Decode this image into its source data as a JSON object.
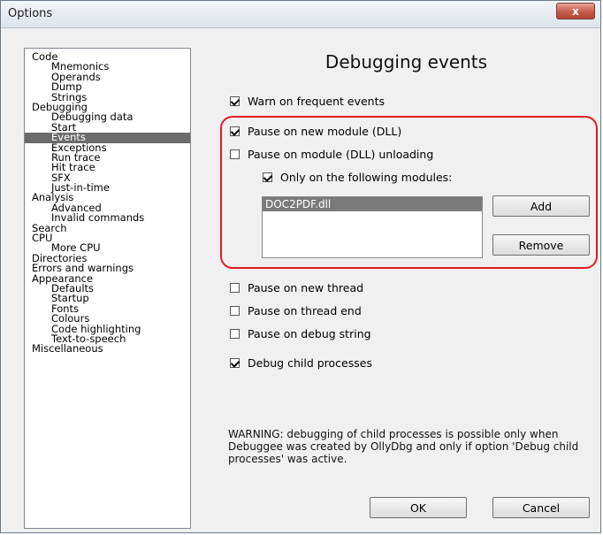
{
  "window": {
    "title": "Options",
    "close_label": "x"
  },
  "tree": {
    "items": [
      {
        "label": "Code",
        "level": 0
      },
      {
        "label": "Mnemonics",
        "level": 1
      },
      {
        "label": "Operands",
        "level": 1
      },
      {
        "label": "Dump",
        "level": 1
      },
      {
        "label": "Strings",
        "level": 1
      },
      {
        "label": "Debugging",
        "level": 0
      },
      {
        "label": "Debugging data",
        "level": 1
      },
      {
        "label": "Start",
        "level": 1
      },
      {
        "label": "Events",
        "level": 1,
        "selected": true
      },
      {
        "label": "Exceptions",
        "level": 1
      },
      {
        "label": "Run trace",
        "level": 1
      },
      {
        "label": "Hit trace",
        "level": 1
      },
      {
        "label": "SFX",
        "level": 1
      },
      {
        "label": "Just-in-time",
        "level": 1
      },
      {
        "label": "Analysis",
        "level": 0
      },
      {
        "label": "Advanced",
        "level": 1
      },
      {
        "label": "Invalid commands",
        "level": 1
      },
      {
        "label": "Search",
        "level": 0
      },
      {
        "label": "CPU",
        "level": 0
      },
      {
        "label": "More CPU",
        "level": 1
      },
      {
        "label": "Directories",
        "level": 0
      },
      {
        "label": "Errors and warnings",
        "level": 0
      },
      {
        "label": "Appearance",
        "level": 0
      },
      {
        "label": "Defaults",
        "level": 1
      },
      {
        "label": "Startup",
        "level": 1
      },
      {
        "label": "Fonts",
        "level": 1
      },
      {
        "label": "Colours",
        "level": 1
      },
      {
        "label": "Code highlighting",
        "level": 1
      },
      {
        "label": "Text-to-speech",
        "level": 1
      },
      {
        "label": "Miscellaneous",
        "level": 0
      }
    ]
  },
  "panel": {
    "title": "Debugging events",
    "options": {
      "warn_frequent": {
        "label": "Warn on frequent events",
        "checked": true
      },
      "pause_new_module": {
        "label": "Pause on new module (DLL)",
        "checked": true
      },
      "pause_module_unload": {
        "label": "Pause on module (DLL) unloading",
        "checked": false
      },
      "only_following": {
        "label": "Only on the following modules:",
        "checked": true
      },
      "pause_new_thread": {
        "label": "Pause on new thread",
        "checked": false
      },
      "pause_thread_end": {
        "label": "Pause on thread end",
        "checked": false
      },
      "pause_debug_string": {
        "label": "Pause on debug string",
        "checked": false
      },
      "debug_child": {
        "label": "Debug child processes",
        "checked": true
      }
    },
    "modules": [
      "DOC2PDF.dll"
    ],
    "add_label": "Add",
    "remove_label": "Remove",
    "warning": "WARNING: debugging of child processes is possible only when Debuggee was created by OllyDbg and only if option 'Debug child processes' was active.",
    "ok_label": "OK",
    "cancel_label": "Cancel"
  },
  "colors": {
    "highlight": "#e01b24",
    "selection": "#6b6b6b"
  }
}
